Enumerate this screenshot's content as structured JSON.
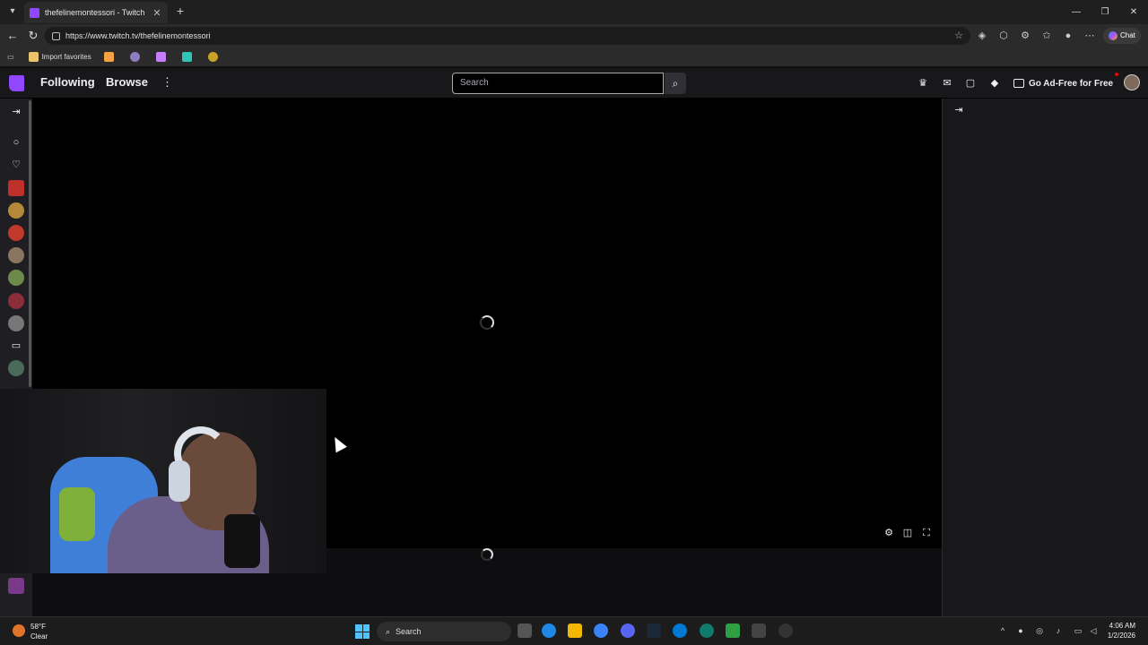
{
  "browser": {
    "tab_title": "thefelinemontessori - Twitch",
    "url": "https://www.twitch.tv/thefelinemontessori",
    "chat_label": "Chat",
    "favorites": {
      "import_label": "Import favorites"
    }
  },
  "twitch": {
    "nav": {
      "following": "Following",
      "browse": "Browse"
    },
    "search": {
      "placeholder": "Search"
    },
    "adfree_label": "Go Ad-Free for Free"
  },
  "taskbar": {
    "weather_temp": "58°F",
    "weather_desc": "Clear",
    "search_label": "Search",
    "time": "4:06 AM",
    "date": "1/2/2026"
  },
  "colors": {
    "twitch_purple": "#9146ff",
    "background": "#0e0e10"
  }
}
